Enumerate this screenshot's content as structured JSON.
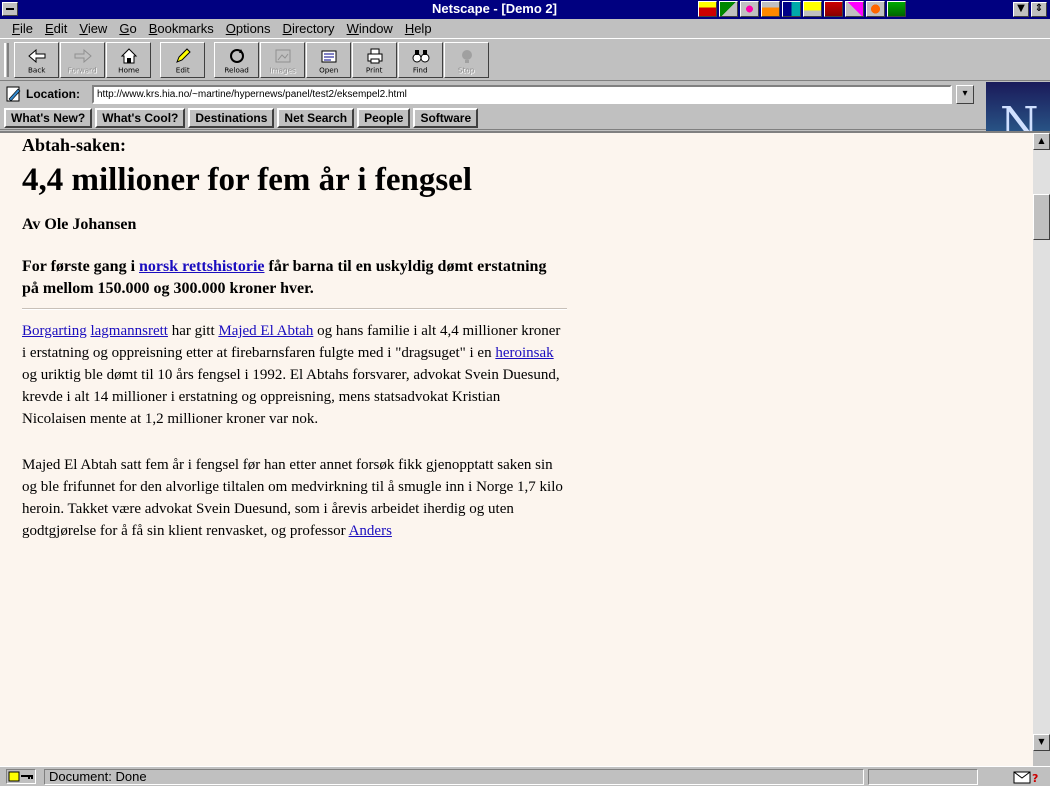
{
  "window": {
    "title": "Netscape - [Demo 2]",
    "min_glyph": "▼",
    "restore_glyph": "⇕"
  },
  "menu": [
    {
      "accel": "F",
      "rest": "ile"
    },
    {
      "accel": "E",
      "rest": "dit"
    },
    {
      "accel": "V",
      "rest": "iew"
    },
    {
      "accel": "G",
      "rest": "o"
    },
    {
      "accel": "B",
      "rest": "ookmarks"
    },
    {
      "accel": "O",
      "rest": "ptions"
    },
    {
      "accel": "D",
      "rest": "irectory"
    },
    {
      "accel": "W",
      "rest": "indow"
    },
    {
      "accel": "H",
      "rest": "elp"
    }
  ],
  "toolbar": {
    "back": "Back",
    "forward": "Forward",
    "home": "Home",
    "edit": "Edit",
    "reload": "Reload",
    "images": "Images",
    "open": "Open",
    "print": "Print",
    "find": "Find",
    "stop": "Stop"
  },
  "location": {
    "label": "Location:",
    "url": "http://www.krs.hia.no/~martine/hypernews/panel/test2/eksempel2.html",
    "dropdown_glyph": "▾"
  },
  "directory_buttons": [
    "What's New?",
    "What's Cool?",
    "Destinations",
    "Net Search",
    "People",
    "Software"
  ],
  "logo_letter": "N",
  "article": {
    "kicker": "Abtah-saken:",
    "headline": "4,4 millioner for fem år i fengsel",
    "byline": "Av Ole Johansen",
    "lead_before": "For første gang i ",
    "lead_link": "norsk rettshistorie",
    "lead_after": " får barna til en uskyldig dømt erstatning på mellom 150.000 og 300.000 kroner hver.",
    "p1": {
      "link1": "Borgarting",
      "link2": "lagmannsrett",
      "t1": " har gitt ",
      "link3": "Majed El Abtah",
      "t2": " og hans familie i alt 4,4 millioner kroner i erstatning og oppreisning etter at firebarnsfaren fulgte med i \"dragsuget\" i en ",
      "link4": "heroinsak",
      "t3": " og uriktig ble dømt til 10 års fengsel i 1992. El Abtahs forsvarer, advokat Svein Duesund, krevde i alt 14 millioner i erstatning og oppreisning, mens statsadvokat Kristian Nicolaisen mente at 1,2 millioner kroner var nok."
    },
    "p2": {
      "text": "Majed El Abtah satt fem år i fengsel før han etter annet forsøk fikk gjenopptatt saken sin og ble frifunnet for den alvorlige tiltalen om medvirkning til å smugle inn i Norge 1,7 kilo heroin. Takket være advokat Svein Duesund, som i årevis arbeidet iherdig og uten godtgjørelse for å få sin klient renvasket, og professor ",
      "link": "Anders"
    }
  },
  "status": {
    "text": "Document: Done"
  },
  "scroll": {
    "up_glyph": "▲",
    "down_glyph": "▼"
  }
}
